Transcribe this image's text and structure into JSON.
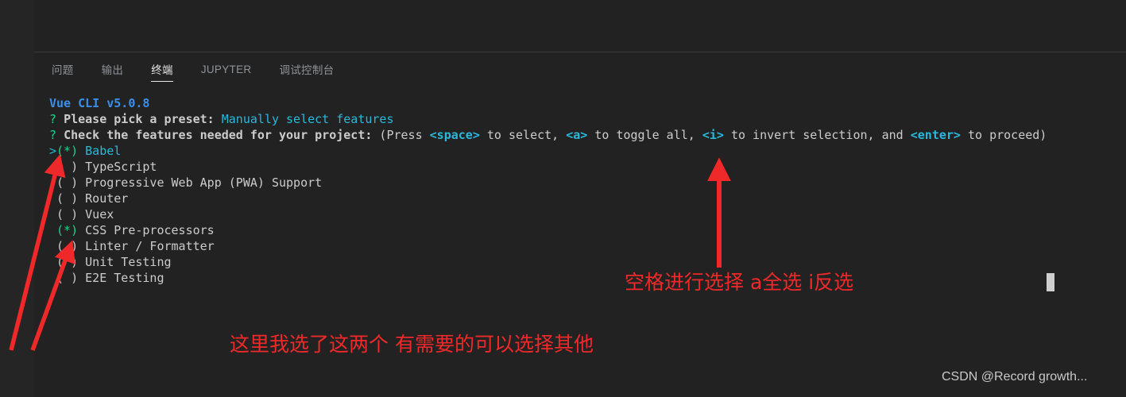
{
  "window": {
    "background_color": "#222222",
    "rail_color": "#252526"
  },
  "panel": {
    "tabs": [
      {
        "label": "问题",
        "active": false
      },
      {
        "label": "输出",
        "active": false
      },
      {
        "label": "终端",
        "active": true
      },
      {
        "label": "JUPYTER",
        "active": false
      },
      {
        "label": "调试控制台",
        "active": false
      }
    ]
  },
  "terminal": {
    "lines": [
      {
        "segments": [
          {
            "text": "Vue CLI v5.0.8",
            "color": "blue",
            "bold": true
          }
        ]
      },
      {
        "segments": [
          {
            "text": "? ",
            "color": "green",
            "bold": false
          },
          {
            "text": "Please pick a preset: ",
            "color": "grey",
            "bold": true
          },
          {
            "text": "Manually select features",
            "color": "cyan",
            "bold": false
          }
        ]
      },
      {
        "segments": [
          {
            "text": "? ",
            "color": "green",
            "bold": false
          },
          {
            "text": "Check the features needed for your project: ",
            "color": "grey",
            "bold": true
          },
          {
            "text": "(Press ",
            "color": "grey",
            "bold": false
          },
          {
            "text": "<space>",
            "color": "cyan",
            "bold": true
          },
          {
            "text": " to select, ",
            "color": "grey",
            "bold": false
          },
          {
            "text": "<a>",
            "color": "cyan",
            "bold": true
          },
          {
            "text": " to toggle all, ",
            "color": "grey",
            "bold": false
          },
          {
            "text": "<i>",
            "color": "cyan",
            "bold": true
          },
          {
            "text": " to invert selection, and ",
            "color": "grey",
            "bold": false
          },
          {
            "text": "<enter>",
            "color": "cyan",
            "bold": true
          },
          {
            "text": " to proceed)",
            "color": "grey",
            "bold": false
          }
        ]
      },
      {
        "segments": [
          {
            "text": ">",
            "color": "cyan",
            "bold": false
          },
          {
            "text": "(*)",
            "color": "green",
            "bold": false
          },
          {
            "text": " ",
            "color": "grey",
            "bold": false
          },
          {
            "text": "Babel",
            "color": "cyan",
            "bold": false
          }
        ]
      },
      {
        "segments": [
          {
            "text": " ( ) ",
            "color": "grey",
            "bold": false
          },
          {
            "text": "TypeScript",
            "color": "grey",
            "bold": false
          }
        ]
      },
      {
        "segments": [
          {
            "text": " ( ) ",
            "color": "grey",
            "bold": false
          },
          {
            "text": "Progressive Web App (PWA) Support",
            "color": "grey",
            "bold": false
          }
        ]
      },
      {
        "segments": [
          {
            "text": " ( ) ",
            "color": "grey",
            "bold": false
          },
          {
            "text": "Router",
            "color": "grey",
            "bold": false
          }
        ]
      },
      {
        "segments": [
          {
            "text": " ( ) ",
            "color": "grey",
            "bold": false
          },
          {
            "text": "Vuex",
            "color": "grey",
            "bold": false
          }
        ]
      },
      {
        "segments": [
          {
            "text": " ",
            "color": "grey",
            "bold": false
          },
          {
            "text": "(*)",
            "color": "green",
            "bold": false
          },
          {
            "text": " ",
            "color": "grey",
            "bold": false
          },
          {
            "text": "CSS Pre-processors",
            "color": "grey",
            "bold": false
          }
        ]
      },
      {
        "segments": [
          {
            "text": " ( ) ",
            "color": "grey",
            "bold": false
          },
          {
            "text": "Linter / Formatter",
            "color": "grey",
            "bold": false
          }
        ]
      },
      {
        "segments": [
          {
            "text": " ( ) ",
            "color": "grey",
            "bold": false
          },
          {
            "text": "Unit Testing",
            "color": "grey",
            "bold": false
          }
        ]
      },
      {
        "segments": [
          {
            "text": " ( ) ",
            "color": "grey",
            "bold": false
          },
          {
            "text": "E2E Testing",
            "color": "grey",
            "bold": false
          }
        ]
      }
    ],
    "cursor_visible": true
  },
  "annotations": {
    "color": "#ef2929",
    "right_note": "空格进行选择 a全选 i反选",
    "bottom_note": "这里我选了这两个 有需要的可以选择其他"
  },
  "watermark": {
    "text": "CSDN @Record growth..."
  }
}
